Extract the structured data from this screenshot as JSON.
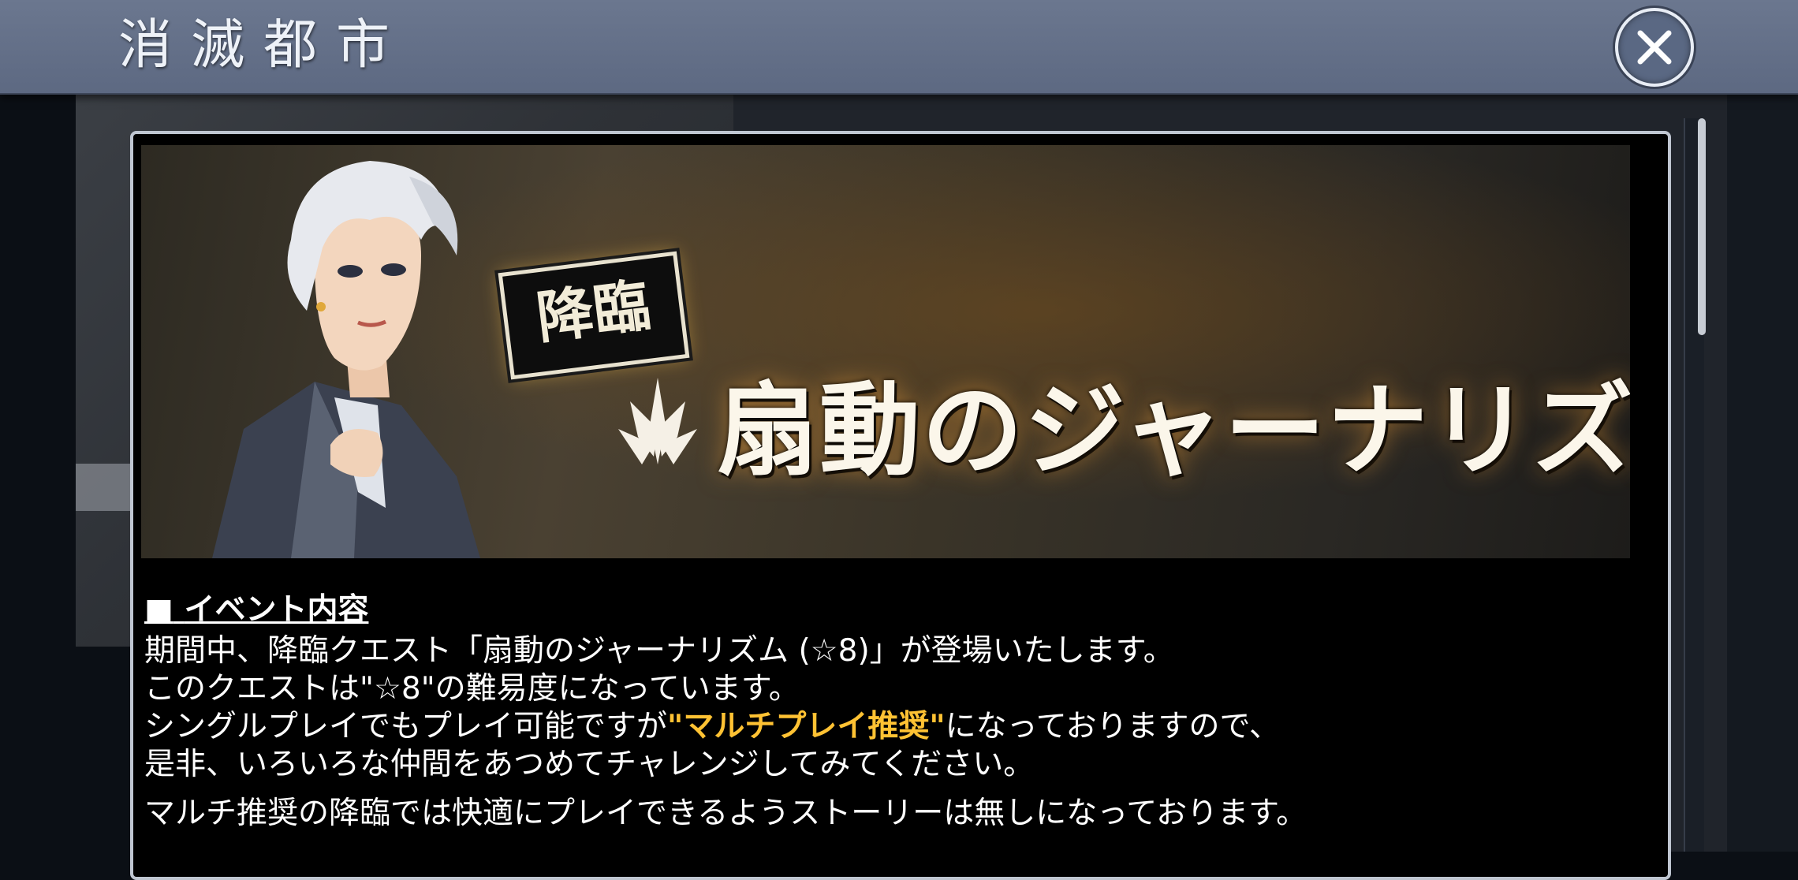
{
  "header": {
    "title": "消滅都市",
    "close_icon": "close-icon"
  },
  "banner": {
    "badge": "降臨",
    "title": "扇動のジャーナリズム",
    "emblem_icon": "fan-emblem-icon"
  },
  "content": {
    "heading_marker": "■",
    "heading": "イベント内容",
    "lines": [
      "期間中、降臨クエスト「扇動のジャーナリズム (☆8)」が登場いたします。",
      "このクエストは\"☆8\"の難易度になっています。"
    ],
    "line3_before": "シングルプレイでもプレイ可能ですが",
    "line3_highlight": "\"マルチプレイ推奨\"",
    "line3_after": "になっておりますので、",
    "line4": "是非、いろいろな仲間をあつめてチャレンジしてみてください。",
    "note": "マルチ推奨の降臨では快適にプレイできるようストーリーは無しになっております。"
  },
  "colors": {
    "header_bg": "#64708a",
    "highlight": "#ffc233",
    "modal_border": "#bfc6d1"
  }
}
